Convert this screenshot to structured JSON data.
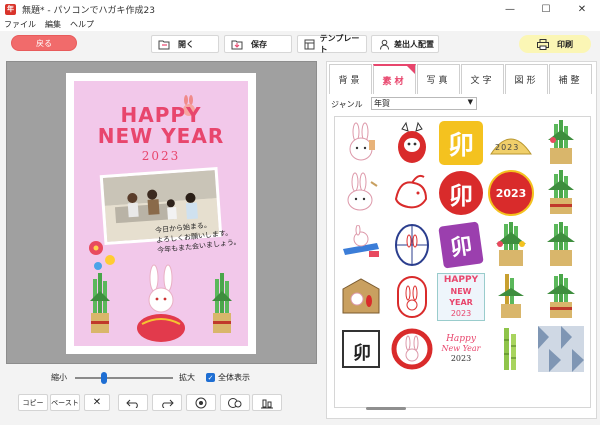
{
  "window": {
    "title": "無題* - パソコンでハガキ作成23",
    "minimize": "—",
    "maximize": "☐",
    "close": "✕",
    "app_icon_label": "年"
  },
  "menu": [
    "ファイル",
    "編集",
    "ヘルプ"
  ],
  "toolbar": {
    "back": "戻る",
    "open": "開く",
    "save": "保存",
    "template": "テンプレート",
    "address": "差出人配置",
    "print": "印刷"
  },
  "card": {
    "happy": "HAPPY",
    "new_year": "NEW YEAR",
    "year": "2023",
    "message": [
      "今日から始まる。",
      "よろしくお願いします。",
      "今年もまた会いましょう。"
    ]
  },
  "zoom": {
    "shrink": "縮小",
    "enlarge": "拡大",
    "fit_all": "全体表示",
    "level": 0.3
  },
  "bottom": {
    "copy": "コピー",
    "paste": "ペースト",
    "delete": "✕"
  },
  "panel": {
    "tabs": [
      "背景",
      "素材",
      "写真",
      "文字",
      "図形",
      "補整"
    ],
    "active_tab": "素材",
    "genre_label": "ジャンル",
    "genre_value": "年賀",
    "genre_arrow": "▼"
  },
  "materials": {
    "text_u": "卯",
    "text_2023": "2023",
    "text_happy": "HAPPY",
    "text_newyear": "NEW YEAR",
    "text_happy_script": "Happy",
    "text_newyear_script": "New Year"
  },
  "colors": {
    "accent": "#e8466d",
    "back_button": "#f16b6b",
    "print_button": "#fbf6b5",
    "card_bg": "#f2c8ea",
    "canvas_bg": "#a0a0a0"
  }
}
